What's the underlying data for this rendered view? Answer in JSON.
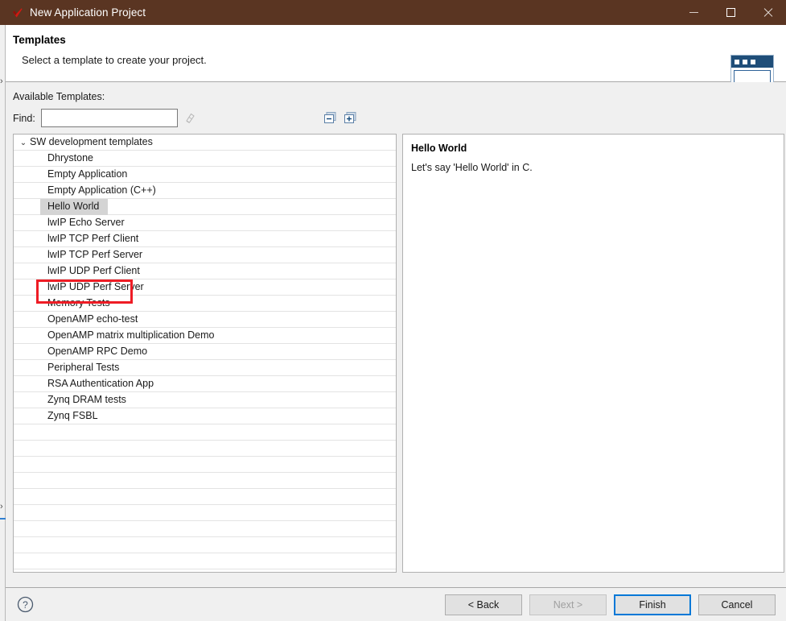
{
  "window": {
    "title": "New Application Project",
    "icon": "red-check-logo-icon",
    "titlebar_color": "#5a3522",
    "controls": {
      "minimize": "Minimize",
      "maximize": "Maximize",
      "close": "Close"
    }
  },
  "header": {
    "title": "Templates",
    "subtitle": "Select a template to create your project.",
    "banner_icon": "wizard-window-banner-icon"
  },
  "main": {
    "available_label": "Available Templates:",
    "find": {
      "label": "Find:",
      "value": "",
      "placeholder": ""
    },
    "clear_icon": "clear-filter-icon",
    "tools": [
      {
        "name": "collapse-all",
        "label": "Collapse All"
      },
      {
        "name": "expand-all",
        "label": "Expand All"
      }
    ],
    "tree": {
      "group": {
        "label": "SW development templates",
        "expanded": true,
        "chevron": "⌄"
      },
      "items": [
        "Dhrystone",
        "Empty Application",
        "Empty Application (C++)",
        "Hello World",
        "lwIP Echo Server",
        "lwIP TCP Perf Client",
        "lwIP TCP Perf Server",
        "lwIP UDP Perf Client",
        "lwIP UDP Perf Server",
        "Memory Tests",
        "OpenAMP echo-test",
        "OpenAMP matrix multiplication Demo",
        "OpenAMP RPC Demo",
        "Peripheral Tests",
        "RSA Authentication App",
        "Zynq DRAM tests",
        "Zynq FSBL"
      ],
      "selected": "Hello World",
      "blank_rows": 9
    },
    "description": {
      "title": "Hello World",
      "text": "Let's say 'Hello World' in C."
    },
    "annotation": {
      "target": "Hello World",
      "color": "#ee1c25"
    }
  },
  "footer": {
    "help_icon": "help-question-icon",
    "buttons": [
      {
        "name": "back",
        "label": "< Back",
        "state": "enabled"
      },
      {
        "name": "next",
        "label": "Next >",
        "state": "disabled"
      },
      {
        "name": "finish",
        "label": "Finish",
        "state": "default"
      },
      {
        "name": "cancel",
        "label": "Cancel",
        "state": "enabled"
      }
    ]
  }
}
